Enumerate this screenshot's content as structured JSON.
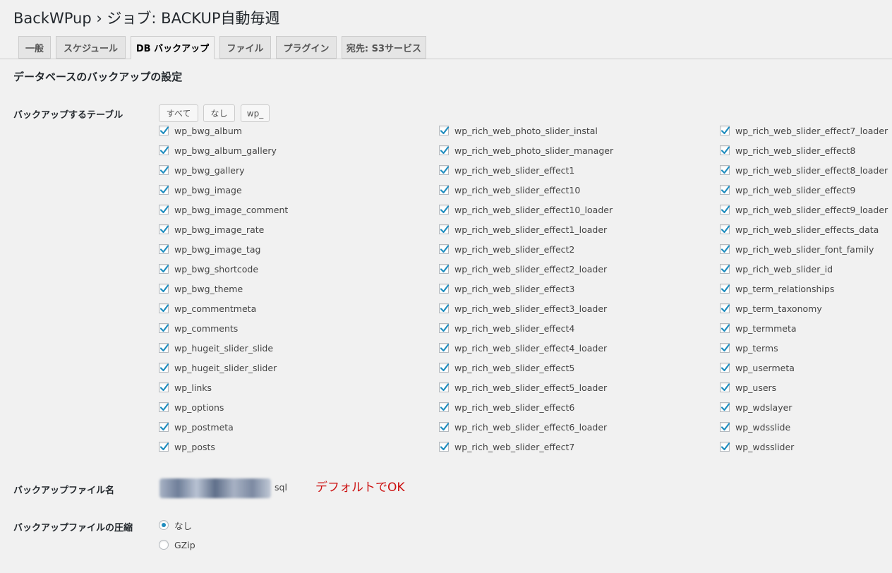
{
  "header": {
    "title": "BackWPup › ジョブ: BACKUP自動毎週"
  },
  "tabs": [
    {
      "label": "一般",
      "active": false
    },
    {
      "label": "スケジュール",
      "active": false
    },
    {
      "label": "DB バックアップ",
      "active": true
    },
    {
      "label": "ファイル",
      "active": false
    },
    {
      "label": "プラグイン",
      "active": false
    },
    {
      "label": "宛先: S3サービス",
      "active": false
    }
  ],
  "section_title": "データベースのバックアップの設定",
  "tables_section": {
    "label": "バックアップするテーブル",
    "buttons": {
      "all": "すべて",
      "none": "なし",
      "prefix": "wp_"
    },
    "columns": [
      [
        "wp_bwg_album",
        "wp_bwg_album_gallery",
        "wp_bwg_gallery",
        "wp_bwg_image",
        "wp_bwg_image_comment",
        "wp_bwg_image_rate",
        "wp_bwg_image_tag",
        "wp_bwg_shortcode",
        "wp_bwg_theme",
        "wp_commentmeta",
        "wp_comments",
        "wp_hugeit_slider_slide",
        "wp_hugeit_slider_slider",
        "wp_links",
        "wp_options",
        "wp_postmeta",
        "wp_posts"
      ],
      [
        "wp_rich_web_photo_slider_instal",
        "wp_rich_web_photo_slider_manager",
        "wp_rich_web_slider_effect1",
        "wp_rich_web_slider_effect10",
        "wp_rich_web_slider_effect10_loader",
        "wp_rich_web_slider_effect1_loader",
        "wp_rich_web_slider_effect2",
        "wp_rich_web_slider_effect2_loader",
        "wp_rich_web_slider_effect3",
        "wp_rich_web_slider_effect3_loader",
        "wp_rich_web_slider_effect4",
        "wp_rich_web_slider_effect4_loader",
        "wp_rich_web_slider_effect5",
        "wp_rich_web_slider_effect5_loader",
        "wp_rich_web_slider_effect6",
        "wp_rich_web_slider_effect6_loader",
        "wp_rich_web_slider_effect7"
      ],
      [
        "wp_rich_web_slider_effect7_loader",
        "wp_rich_web_slider_effect8",
        "wp_rich_web_slider_effect8_loader",
        "wp_rich_web_slider_effect9",
        "wp_rich_web_slider_effect9_loader",
        "wp_rich_web_slider_effects_data",
        "wp_rich_web_slider_font_family",
        "wp_rich_web_slider_id",
        "wp_term_relationships",
        "wp_term_taxonomy",
        "wp_termmeta",
        "wp_terms",
        "wp_usermeta",
        "wp_users",
        "wp_wdslayer",
        "wp_wdsslide",
        "wp_wdsslider"
      ]
    ]
  },
  "filename_section": {
    "label": "バックアップファイル名",
    "extension": "sql",
    "annotation": "デフォルトでOK"
  },
  "compression_section": {
    "label": "バックアップファイルの圧縮",
    "options": [
      {
        "label": "なし",
        "checked": true
      },
      {
        "label": "GZip",
        "checked": false
      }
    ]
  },
  "colors": {
    "checkmark": "#1e8cbe",
    "annotation": "#cc1111"
  }
}
